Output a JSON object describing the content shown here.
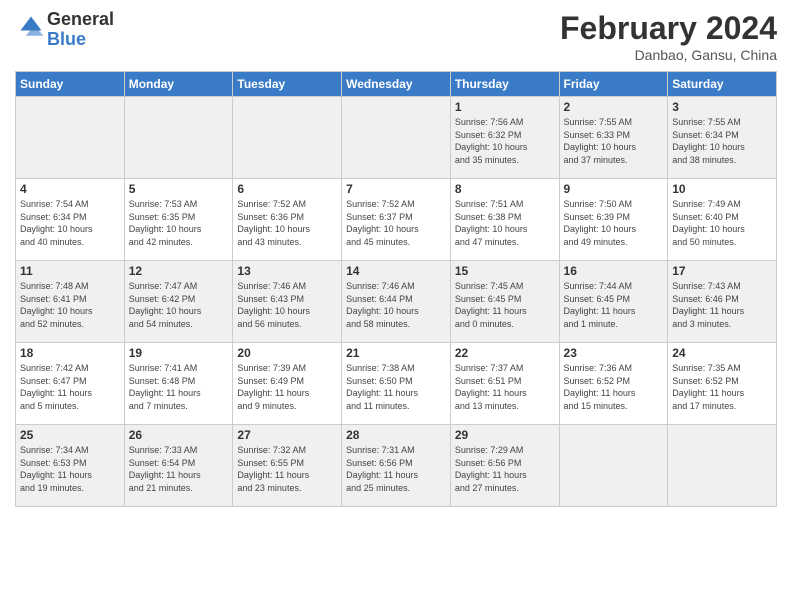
{
  "logo": {
    "line1": "General",
    "line2": "Blue"
  },
  "header": {
    "month_year": "February 2024",
    "location": "Danbao, Gansu, China"
  },
  "days_of_week": [
    "Sunday",
    "Monday",
    "Tuesday",
    "Wednesday",
    "Thursday",
    "Friday",
    "Saturday"
  ],
  "weeks": [
    [
      {
        "day": "",
        "info": ""
      },
      {
        "day": "",
        "info": ""
      },
      {
        "day": "",
        "info": ""
      },
      {
        "day": "",
        "info": ""
      },
      {
        "day": "1",
        "info": "Sunrise: 7:56 AM\nSunset: 6:32 PM\nDaylight: 10 hours\nand 35 minutes."
      },
      {
        "day": "2",
        "info": "Sunrise: 7:55 AM\nSunset: 6:33 PM\nDaylight: 10 hours\nand 37 minutes."
      },
      {
        "day": "3",
        "info": "Sunrise: 7:55 AM\nSunset: 6:34 PM\nDaylight: 10 hours\nand 38 minutes."
      }
    ],
    [
      {
        "day": "4",
        "info": "Sunrise: 7:54 AM\nSunset: 6:34 PM\nDaylight: 10 hours\nand 40 minutes."
      },
      {
        "day": "5",
        "info": "Sunrise: 7:53 AM\nSunset: 6:35 PM\nDaylight: 10 hours\nand 42 minutes."
      },
      {
        "day": "6",
        "info": "Sunrise: 7:52 AM\nSunset: 6:36 PM\nDaylight: 10 hours\nand 43 minutes."
      },
      {
        "day": "7",
        "info": "Sunrise: 7:52 AM\nSunset: 6:37 PM\nDaylight: 10 hours\nand 45 minutes."
      },
      {
        "day": "8",
        "info": "Sunrise: 7:51 AM\nSunset: 6:38 PM\nDaylight: 10 hours\nand 47 minutes."
      },
      {
        "day": "9",
        "info": "Sunrise: 7:50 AM\nSunset: 6:39 PM\nDaylight: 10 hours\nand 49 minutes."
      },
      {
        "day": "10",
        "info": "Sunrise: 7:49 AM\nSunset: 6:40 PM\nDaylight: 10 hours\nand 50 minutes."
      }
    ],
    [
      {
        "day": "11",
        "info": "Sunrise: 7:48 AM\nSunset: 6:41 PM\nDaylight: 10 hours\nand 52 minutes."
      },
      {
        "day": "12",
        "info": "Sunrise: 7:47 AM\nSunset: 6:42 PM\nDaylight: 10 hours\nand 54 minutes."
      },
      {
        "day": "13",
        "info": "Sunrise: 7:46 AM\nSunset: 6:43 PM\nDaylight: 10 hours\nand 56 minutes."
      },
      {
        "day": "14",
        "info": "Sunrise: 7:46 AM\nSunset: 6:44 PM\nDaylight: 10 hours\nand 58 minutes."
      },
      {
        "day": "15",
        "info": "Sunrise: 7:45 AM\nSunset: 6:45 PM\nDaylight: 11 hours\nand 0 minutes."
      },
      {
        "day": "16",
        "info": "Sunrise: 7:44 AM\nSunset: 6:45 PM\nDaylight: 11 hours\nand 1 minute."
      },
      {
        "day": "17",
        "info": "Sunrise: 7:43 AM\nSunset: 6:46 PM\nDaylight: 11 hours\nand 3 minutes."
      }
    ],
    [
      {
        "day": "18",
        "info": "Sunrise: 7:42 AM\nSunset: 6:47 PM\nDaylight: 11 hours\nand 5 minutes."
      },
      {
        "day": "19",
        "info": "Sunrise: 7:41 AM\nSunset: 6:48 PM\nDaylight: 11 hours\nand 7 minutes."
      },
      {
        "day": "20",
        "info": "Sunrise: 7:39 AM\nSunset: 6:49 PM\nDaylight: 11 hours\nand 9 minutes."
      },
      {
        "day": "21",
        "info": "Sunrise: 7:38 AM\nSunset: 6:50 PM\nDaylight: 11 hours\nand 11 minutes."
      },
      {
        "day": "22",
        "info": "Sunrise: 7:37 AM\nSunset: 6:51 PM\nDaylight: 11 hours\nand 13 minutes."
      },
      {
        "day": "23",
        "info": "Sunrise: 7:36 AM\nSunset: 6:52 PM\nDaylight: 11 hours\nand 15 minutes."
      },
      {
        "day": "24",
        "info": "Sunrise: 7:35 AM\nSunset: 6:52 PM\nDaylight: 11 hours\nand 17 minutes."
      }
    ],
    [
      {
        "day": "25",
        "info": "Sunrise: 7:34 AM\nSunset: 6:53 PM\nDaylight: 11 hours\nand 19 minutes."
      },
      {
        "day": "26",
        "info": "Sunrise: 7:33 AM\nSunset: 6:54 PM\nDaylight: 11 hours\nand 21 minutes."
      },
      {
        "day": "27",
        "info": "Sunrise: 7:32 AM\nSunset: 6:55 PM\nDaylight: 11 hours\nand 23 minutes."
      },
      {
        "day": "28",
        "info": "Sunrise: 7:31 AM\nSunset: 6:56 PM\nDaylight: 11 hours\nand 25 minutes."
      },
      {
        "day": "29",
        "info": "Sunrise: 7:29 AM\nSunset: 6:56 PM\nDaylight: 11 hours\nand 27 minutes."
      },
      {
        "day": "",
        "info": ""
      },
      {
        "day": "",
        "info": ""
      }
    ]
  ]
}
